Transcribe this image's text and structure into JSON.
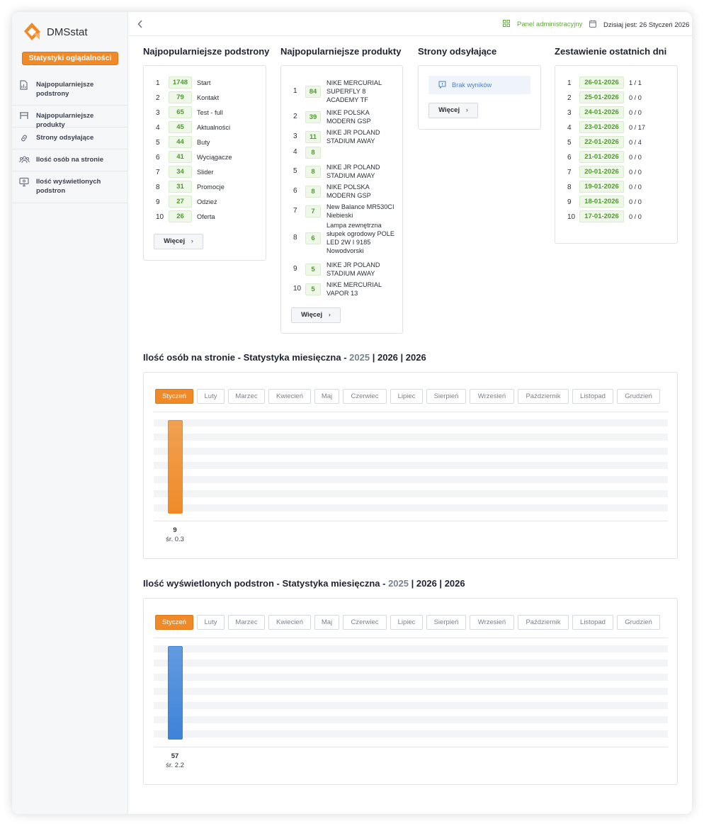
{
  "app": {
    "name": "DMSstat",
    "primary_button": "Statystyki oglądalności"
  },
  "sidebar": {
    "items": [
      {
        "label": "Najpopularniejsze podstrony",
        "icon": "document-icon"
      },
      {
        "label": "Najpopularniejsze produkty",
        "icon": "shelf-icon"
      },
      {
        "label": "Strony odsyłające",
        "icon": "link-icon"
      },
      {
        "label": "Ilość osób na stronie",
        "icon": "users-icon"
      },
      {
        "label": "Ilość wyświetlonych podstron",
        "icon": "monitor-icon"
      }
    ]
  },
  "topbar": {
    "admin_label": "Panel administracyjny",
    "today_label": "Dzisiaj jest: 26 Styczeń 2026"
  },
  "more_label": "Więcej",
  "subpages": {
    "title": "Najpopularniejsze podstrony",
    "rows": [
      {
        "rank": "1",
        "count": "1748",
        "name": "Start"
      },
      {
        "rank": "2",
        "count": "79",
        "name": "Kontakt"
      },
      {
        "rank": "3",
        "count": "65",
        "name": "Test - full"
      },
      {
        "rank": "4",
        "count": "45",
        "name": "Aktualności"
      },
      {
        "rank": "5",
        "count": "44",
        "name": "Buty"
      },
      {
        "rank": "6",
        "count": "41",
        "name": "Wyciągacze"
      },
      {
        "rank": "7",
        "count": "34",
        "name": "Slider"
      },
      {
        "rank": "8",
        "count": "31",
        "name": "Promocje"
      },
      {
        "rank": "9",
        "count": "27",
        "name": "Odzież"
      },
      {
        "rank": "10",
        "count": "26",
        "name": "Oferta"
      }
    ]
  },
  "products": {
    "title": "Najpopularniejsze produkty",
    "rows": [
      {
        "rank": "1",
        "count": "84",
        "name": "NIKE MERCURIAL SUPERFLY 8 ACADEMY TF"
      },
      {
        "rank": "2",
        "count": "39",
        "name": "NIKE POLSKA MODERN GSP"
      },
      {
        "rank": "3",
        "count": "11",
        "name": "NIKE JR POLAND STADIUM AWAY"
      },
      {
        "rank": "4",
        "count": "8",
        "name": ""
      },
      {
        "rank": "5",
        "count": "8",
        "name": "NIKE JR POLAND STADIUM AWAY"
      },
      {
        "rank": "6",
        "count": "8",
        "name": "NIKE POLSKA MODERN GSP"
      },
      {
        "rank": "7",
        "count": "7",
        "name": "New Balance MR530CI Niebieski"
      },
      {
        "rank": "8",
        "count": "6",
        "name": "Lampa zewnętrzna słupek ogrodowy POLE LED 2W I 9185 Nowodvorski"
      },
      {
        "rank": "9",
        "count": "5",
        "name": "NIKE JR POLAND STADIUM AWAY"
      },
      {
        "rank": "10",
        "count": "5",
        "name": "NIKE MERCURIAL VAPOR 13"
      }
    ]
  },
  "referrers": {
    "title": "Strony odsyłające",
    "empty_label": "Brak wyników"
  },
  "recent": {
    "title": "Zestawienie ostatnich dni",
    "rows": [
      {
        "rank": "1",
        "date": "26-01-2026",
        "value": "1 / 1"
      },
      {
        "rank": "2",
        "date": "25-01-2026",
        "value": "0 / 0"
      },
      {
        "rank": "3",
        "date": "24-01-2026",
        "value": "0 / 0"
      },
      {
        "rank": "4",
        "date": "23-01-2026",
        "value": "0 / 17"
      },
      {
        "rank": "5",
        "date": "22-01-2026",
        "value": "0 / 4"
      },
      {
        "rank": "6",
        "date": "21-01-2026",
        "value": "0 / 0"
      },
      {
        "rank": "7",
        "date": "20-01-2026",
        "value": "0 / 0"
      },
      {
        "rank": "8",
        "date": "19-01-2026",
        "value": "0 / 0"
      },
      {
        "rank": "9",
        "date": "18-01-2026",
        "value": "0 / 0"
      },
      {
        "rank": "10",
        "date": "17-01-2026",
        "value": "0 / 0"
      }
    ]
  },
  "months": [
    "Styczeń",
    "Luty",
    "Marzec",
    "Kwiecień",
    "Maj",
    "Czerwiec",
    "Lipiec",
    "Sierpień",
    "Wrzesień",
    "Październik",
    "Listopad",
    "Grudzień"
  ],
  "visitors": {
    "title_prefix": "Ilość osób na stronie - Statystyka miesięczna -",
    "years": [
      "2025",
      "2026",
      "2026"
    ],
    "separator": "|",
    "active_month": "Styczeń",
    "bar_value": "9",
    "bar_avg": "śr. 0.3",
    "bar_fill": 0.92,
    "color": "#f08a28"
  },
  "pageviews": {
    "title_prefix": "Ilość wyświetlonych podstron - Statystyka miesięczna -",
    "years": [
      "2025",
      "2026",
      "2026"
    ],
    "separator": "|",
    "active_month": "Styczeń",
    "bar_value": "57",
    "bar_avg": "śr. 2.2",
    "bar_fill": 0.92,
    "color": "#3d83d9"
  }
}
